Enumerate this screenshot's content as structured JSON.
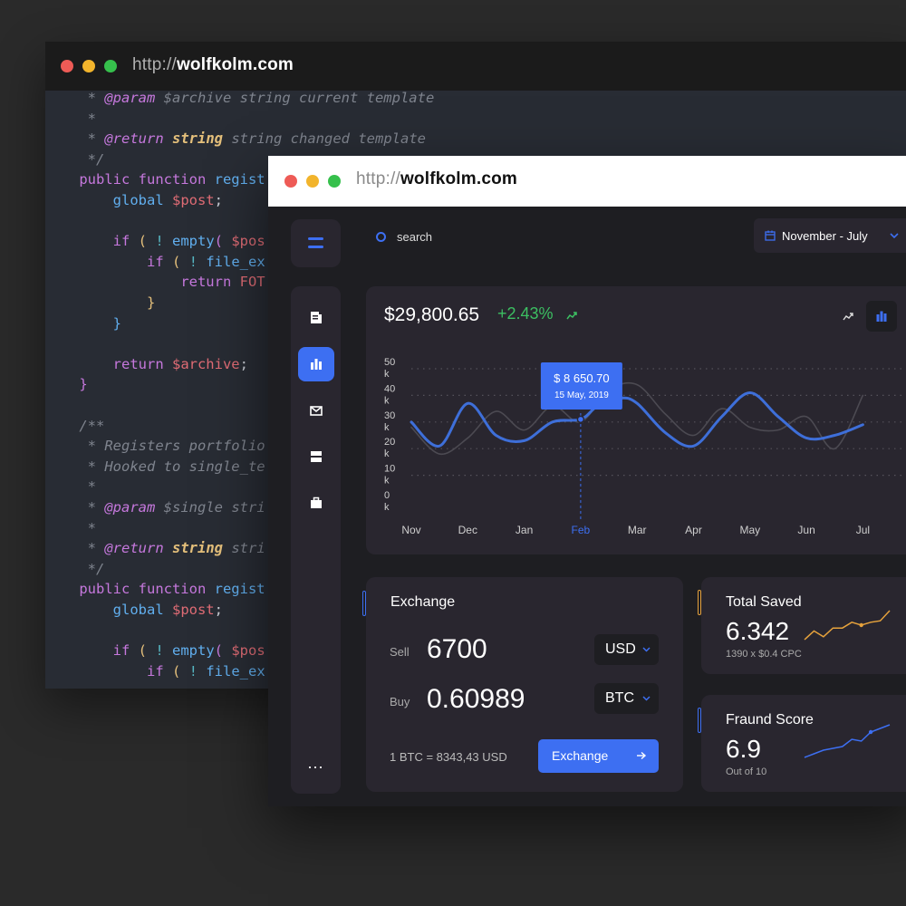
{
  "back_window": {
    "url_protocol": "http://",
    "url_host": "wolfkolm.com",
    "code_lines": [
      {
        "top": 0,
        "indent": "     ",
        "tokens": [
          [
            "c-com",
            "* "
          ],
          [
            "c-tag",
            "@param"
          ],
          [
            "c-com",
            " $archive string current template"
          ]
        ]
      },
      {
        "top": 0,
        "indent": "     ",
        "tokens": [
          [
            "c-com",
            "*"
          ]
        ]
      },
      {
        "top": 0,
        "indent": "     ",
        "tokens": [
          [
            "c-com",
            "* "
          ],
          [
            "c-tag",
            "@return"
          ],
          [
            "c-com",
            " "
          ],
          [
            "c-typ",
            "string"
          ],
          [
            "c-com",
            " string changed template"
          ]
        ]
      },
      {
        "top": 0,
        "indent": "     ",
        "tokens": [
          [
            "c-com",
            "*/"
          ]
        ]
      },
      {
        "top": 0,
        "indent": "    ",
        "tokens": [
          [
            "c-kw",
            "public function "
          ],
          [
            "c-fn",
            "regist"
          ]
        ]
      },
      {
        "top": 0,
        "indent": "        ",
        "tokens": [
          [
            "c-fn",
            "global "
          ],
          [
            "c-var",
            "$post"
          ],
          [
            "c-txt",
            ";"
          ]
        ]
      },
      {
        "top": 0,
        "indent": "",
        "tokens": []
      },
      {
        "top": 0,
        "indent": "        ",
        "tokens": [
          [
            "c-kw",
            "if "
          ],
          [
            "c-br1",
            "( "
          ],
          [
            "c-op",
            "! "
          ],
          [
            "c-fn",
            "empty"
          ],
          [
            "c-br3",
            "( "
          ],
          [
            "c-var",
            "$pos"
          ]
        ]
      },
      {
        "top": 0,
        "indent": "            ",
        "tokens": [
          [
            "c-kw",
            "if "
          ],
          [
            "c-br1",
            "( "
          ],
          [
            "c-op",
            "! "
          ],
          [
            "c-fn",
            "file_ex"
          ]
        ]
      },
      {
        "top": 0,
        "indent": "                ",
        "tokens": [
          [
            "c-kw",
            "return "
          ],
          [
            "c-var",
            "FOT"
          ]
        ]
      },
      {
        "top": 0,
        "indent": "            ",
        "tokens": [
          [
            "c-br1",
            "}"
          ]
        ]
      },
      {
        "top": 0,
        "indent": "        ",
        "tokens": [
          [
            "c-br2",
            "}"
          ]
        ]
      },
      {
        "top": 0,
        "indent": "",
        "tokens": []
      },
      {
        "top": 0,
        "indent": "        ",
        "tokens": [
          [
            "c-kw",
            "return "
          ],
          [
            "c-var",
            "$archive"
          ],
          [
            "c-txt",
            ";"
          ]
        ]
      },
      {
        "top": 0,
        "indent": "    ",
        "tokens": [
          [
            "c-br3",
            "}"
          ]
        ]
      },
      {
        "top": 0,
        "indent": "",
        "tokens": []
      },
      {
        "top": 0,
        "indent": "    ",
        "tokens": [
          [
            "c-com",
            "/**"
          ]
        ]
      },
      {
        "top": 0,
        "indent": "     ",
        "tokens": [
          [
            "c-com",
            "* Registers portfolio"
          ]
        ]
      },
      {
        "top": 0,
        "indent": "     ",
        "tokens": [
          [
            "c-com",
            "* Hooked to single_te"
          ]
        ]
      },
      {
        "top": 0,
        "indent": "     ",
        "tokens": [
          [
            "c-com",
            "*"
          ]
        ]
      },
      {
        "top": 0,
        "indent": "     ",
        "tokens": [
          [
            "c-com",
            "* "
          ],
          [
            "c-tag",
            "@param"
          ],
          [
            "c-com",
            " $single stri"
          ]
        ]
      },
      {
        "top": 0,
        "indent": "     ",
        "tokens": [
          [
            "c-com",
            "*"
          ]
        ]
      },
      {
        "top": 0,
        "indent": "     ",
        "tokens": [
          [
            "c-com",
            "* "
          ],
          [
            "c-tag",
            "@return"
          ],
          [
            "c-com",
            " "
          ],
          [
            "c-typ",
            "string"
          ],
          [
            "c-com",
            " stri"
          ]
        ]
      },
      {
        "top": 0,
        "indent": "     ",
        "tokens": [
          [
            "c-com",
            "*/"
          ]
        ]
      },
      {
        "top": 0,
        "indent": "    ",
        "tokens": [
          [
            "c-kw",
            "public function "
          ],
          [
            "c-fn",
            "regist"
          ]
        ]
      },
      {
        "top": 0,
        "indent": "        ",
        "tokens": [
          [
            "c-fn",
            "global "
          ],
          [
            "c-var",
            "$post"
          ],
          [
            "c-txt",
            ";"
          ]
        ]
      },
      {
        "top": 0,
        "indent": "",
        "tokens": []
      },
      {
        "top": 0,
        "indent": "        ",
        "tokens": [
          [
            "c-kw",
            "if "
          ],
          [
            "c-br1",
            "( "
          ],
          [
            "c-op",
            "! "
          ],
          [
            "c-fn",
            "empty"
          ],
          [
            "c-br3",
            "( "
          ],
          [
            "c-var",
            "$pos"
          ]
        ]
      },
      {
        "top": 0,
        "indent": "            ",
        "tokens": [
          [
            "c-kw",
            "if "
          ],
          [
            "c-br1",
            "( "
          ],
          [
            "c-op",
            "! "
          ],
          [
            "c-fn",
            "file_ex"
          ]
        ]
      }
    ]
  },
  "front_window": {
    "url_protocol": "http://",
    "url_host": "wolfkolm.com"
  },
  "sidebar": {
    "items": [
      {
        "name": "sidebar-item-documents",
        "icon": "document-icon",
        "active": false
      },
      {
        "name": "sidebar-item-analytics",
        "icon": "bar-chart-icon",
        "active": true
      },
      {
        "name": "sidebar-item-messages",
        "icon": "mail-icon",
        "active": false
      },
      {
        "name": "sidebar-item-storage",
        "icon": "server-icon",
        "active": false
      },
      {
        "name": "sidebar-item-portfolio",
        "icon": "briefcase-icon",
        "active": false
      }
    ],
    "more_label": "..."
  },
  "header": {
    "search_placeholder": "search",
    "date_range": "November - July"
  },
  "chart_card": {
    "price": "$29,800.65",
    "change": "+2.43%",
    "tooltip_value": "$ 8 650.70",
    "tooltip_date": "15 May, 2019"
  },
  "chart_data": {
    "type": "line",
    "title": "",
    "xlabel": "",
    "ylabel": "",
    "categories": [
      "Nov",
      "Dec",
      "Jan",
      "Feb",
      "Mar",
      "Apr",
      "May",
      "Jun",
      "Jul"
    ],
    "y_ticks": [
      {
        "value": 0,
        "line1": "0",
        "line2": "k"
      },
      {
        "value": 10,
        "line1": "10",
        "line2": "k"
      },
      {
        "value": 20,
        "line1": "20",
        "line2": "k"
      },
      {
        "value": 30,
        "line1": "30",
        "line2": "k"
      },
      {
        "value": 40,
        "line1": "40",
        "line2": "k"
      },
      {
        "value": 50,
        "line1": "50",
        "line2": "k"
      }
    ],
    "ylim": [
      0,
      50
    ],
    "grid": true,
    "highlight_category": "Feb",
    "series": [
      {
        "color": "#3e6fd9",
        "x": [
          0,
          0.5,
          1.0,
          1.5,
          2.0,
          2.5,
          3.0,
          3.3,
          3.7,
          4.0,
          4.5,
          5.0,
          5.5,
          6.0,
          6.5,
          7.0,
          7.5,
          8.0
        ],
        "values": [
          30,
          21,
          37,
          25,
          23,
          30,
          31,
          36,
          39,
          37,
          26,
          21,
          32,
          41,
          32,
          24,
          25,
          29
        ]
      },
      {
        "color": "#4c4a52",
        "x": [
          0,
          0.5,
          1.0,
          1.5,
          2.0,
          2.5,
          3.0,
          3.5,
          4.0,
          4.5,
          5.0,
          5.5,
          6.0,
          6.5,
          7.0,
          7.5,
          8.0
        ],
        "values": [
          28,
          18,
          24,
          34,
          27,
          36,
          30,
          42,
          44,
          33,
          25,
          35,
          28,
          27,
          32,
          20,
          40
        ]
      }
    ]
  },
  "exchange": {
    "title": "Exchange",
    "sell_label": "Sell",
    "sell_value": "6700",
    "sell_currency": "USD",
    "buy_label": "Buy",
    "buy_value": "0.60989",
    "buy_currency": "BTC",
    "rate": "1 BTC = 8343,43  USD",
    "button": "Exchange"
  },
  "total_saved": {
    "title": "Total Saved",
    "value": "6.342",
    "sub": "1390 x $0.4 CPC",
    "accent": "#e6a23c",
    "spark": [
      2,
      5,
      3,
      6,
      6,
      8,
      7,
      8,
      8.5,
      12
    ]
  },
  "fraud_score": {
    "title": "Fraund Score",
    "value": "6.9",
    "sub": "Out of 10",
    "accent": "#3d6ff2",
    "spark": [
      2,
      3,
      4,
      4.5,
      5,
      7,
      6.5,
      9,
      10,
      11
    ]
  }
}
